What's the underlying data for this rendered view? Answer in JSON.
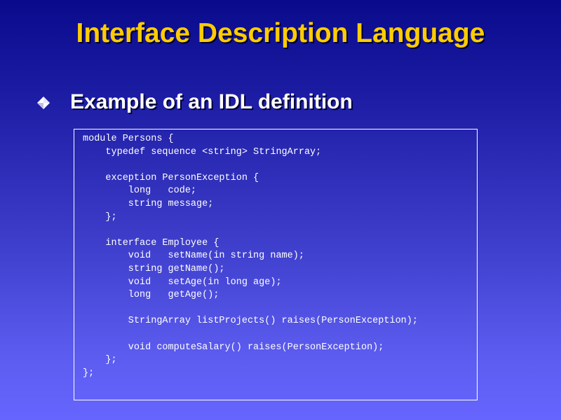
{
  "slide": {
    "title": "Interface Description Language",
    "bullet_text": "Example of an IDL definition",
    "bullet_icon": "diamond-bullet-icon",
    "colors": {
      "title": "#ffcc00",
      "text": "#ffffff",
      "background_top": "#0a0a8c",
      "background_bottom": "#6666ff"
    }
  },
  "code": {
    "lines": [
      "module Persons {",
      "    typedef sequence <string> StringArray;",
      "",
      "    exception PersonException {",
      "        long   code;",
      "        string message;",
      "    };",
      "",
      "    interface Employee {",
      "        void   setName(in string name);",
      "        string getName();",
      "        void   setAge(in long age);",
      "        long   getAge();",
      "",
      "        StringArray listProjects() raises(PersonException);",
      "",
      "        void computeSalary() raises(PersonException);",
      "    };",
      "};"
    ]
  }
}
